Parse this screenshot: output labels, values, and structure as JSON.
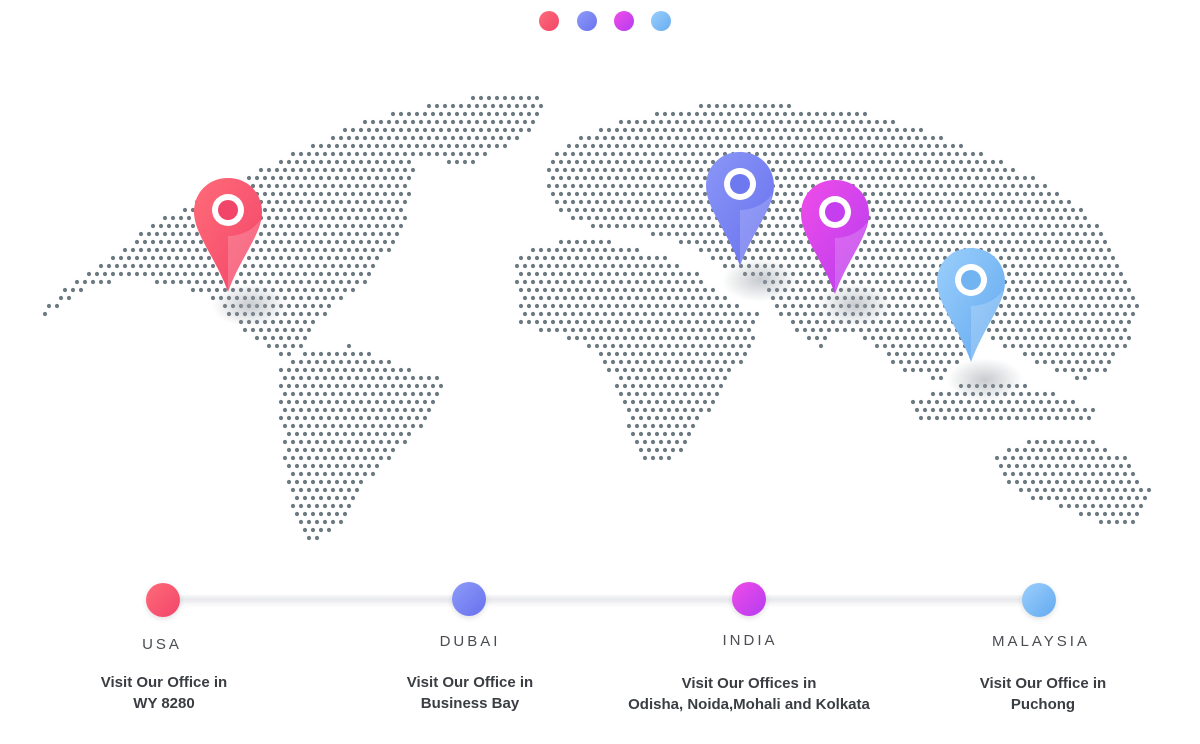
{
  "colors": {
    "usa": [
      "#ff5f6d",
      "#f34a6b"
    ],
    "dubai": [
      "#7b8ff7",
      "#6a6ff0"
    ],
    "india": [
      "#ea3ce5",
      "#c33cf0"
    ],
    "malaysia": [
      "#8ec5fc",
      "#63a9f0"
    ],
    "map_dot": "#6e7a82"
  },
  "locations": [
    {
      "id": "usa",
      "name": "USA",
      "line1": "Visit Our Office in",
      "line2": "WY 8280"
    },
    {
      "id": "dubai",
      "name": "DUBAI",
      "line1": "Visit Our Office in",
      "line2": "Business Bay"
    },
    {
      "id": "india",
      "name": "INDIA",
      "line1": "Visit Our Offices in",
      "line2": "Odisha, Noida,Mohali and Kolkata"
    },
    {
      "id": "malaysia",
      "name": "MALAYSIA",
      "line1": "Visit Our Office in",
      "line2": "Puchong"
    }
  ],
  "icons": [
    "location-pin-icon",
    "dotted-world-map"
  ]
}
